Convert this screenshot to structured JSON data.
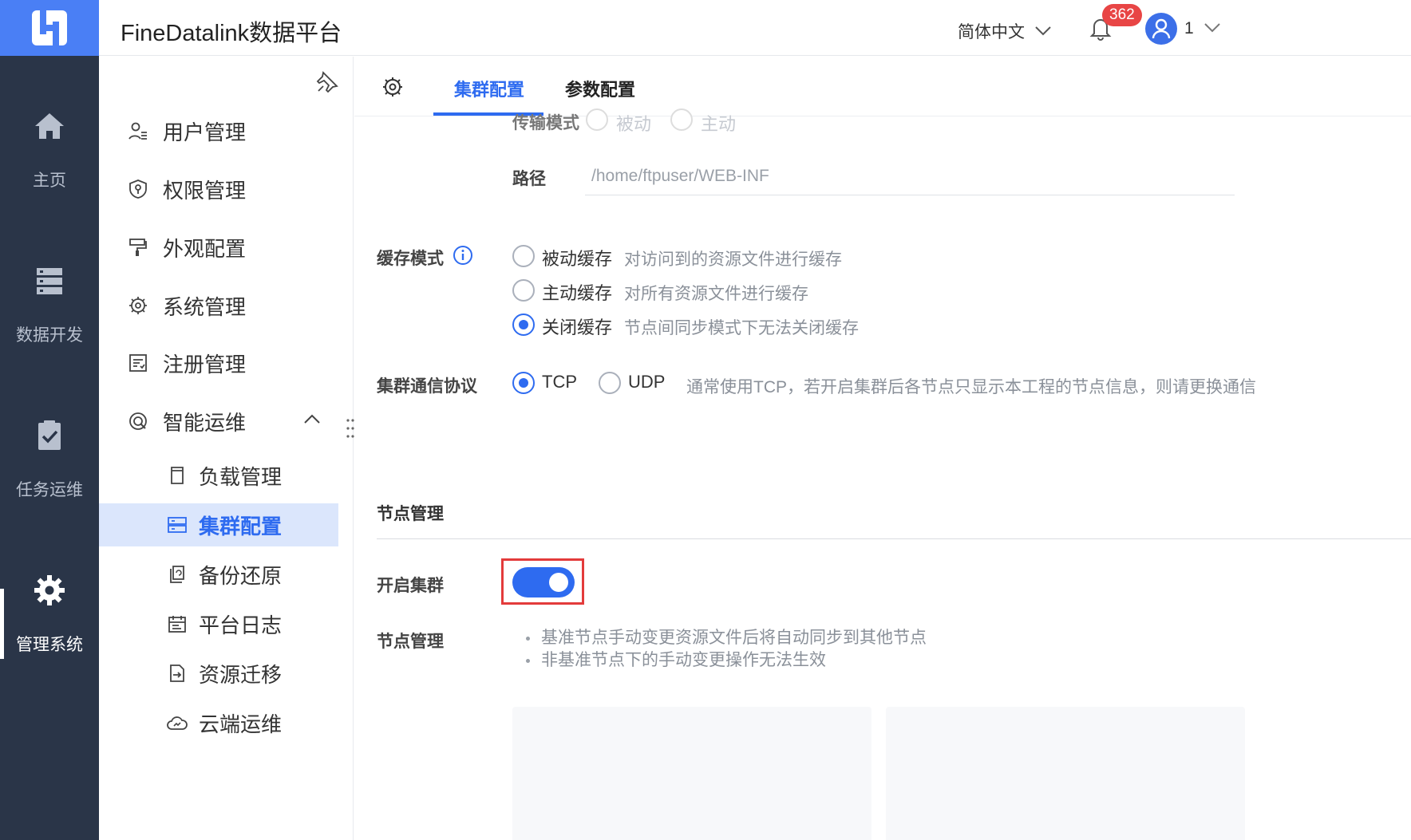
{
  "app": {
    "title": "FineDatalink数据平台",
    "language": "简体中文",
    "notification_count": "362",
    "user_name": "1"
  },
  "rail": {
    "items": [
      {
        "label": "主页",
        "icon": "home-icon"
      },
      {
        "label": "数据开发",
        "icon": "server-icon"
      },
      {
        "label": "任务运维",
        "icon": "clipboard-check-icon"
      },
      {
        "label": "管理系统",
        "icon": "gear-icon",
        "active": true
      }
    ]
  },
  "sidebar": {
    "items": [
      {
        "label": "用户管理",
        "icon": "user-list-icon"
      },
      {
        "label": "权限管理",
        "icon": "shield-key-icon"
      },
      {
        "label": "外观配置",
        "icon": "paint-roller-icon"
      },
      {
        "label": "系统管理",
        "icon": "gear-icon"
      },
      {
        "label": "注册管理",
        "icon": "register-icon"
      },
      {
        "label": "智能运维",
        "icon": "ops-icon",
        "expanded": true
      }
    ],
    "sub_items": [
      {
        "label": "负载管理",
        "icon": "card-icon"
      },
      {
        "label": "集群配置",
        "icon": "server-rack-icon",
        "active": true
      },
      {
        "label": "备份还原",
        "icon": "backup-icon"
      },
      {
        "label": "平台日志",
        "icon": "calendar-log-icon"
      },
      {
        "label": "资源迁移",
        "icon": "migrate-icon"
      },
      {
        "label": "云端运维",
        "icon": "cloud-icon"
      }
    ]
  },
  "tabs": {
    "items": [
      {
        "label": "集群配置",
        "active": true
      },
      {
        "label": "参数配置",
        "active": false
      }
    ]
  },
  "config": {
    "transfer_mode": {
      "label": "传输模式",
      "options": [
        "被动",
        "主动"
      ]
    },
    "path": {
      "label": "路径",
      "value": "/home/ftpuser/WEB-INF"
    },
    "cache_mode": {
      "label": "缓存模式",
      "options": [
        {
          "label": "被动缓存",
          "desc": "对访问到的资源文件进行缓存",
          "checked": false
        },
        {
          "label": "主动缓存",
          "desc": "对所有资源文件进行缓存",
          "checked": false
        },
        {
          "label": "关闭缓存",
          "desc": "节点间同步模式下无法关闭缓存",
          "checked": true
        }
      ]
    },
    "protocol": {
      "label": "集群通信协议",
      "options": [
        {
          "label": "TCP",
          "checked": true
        },
        {
          "label": "UDP",
          "checked": false
        }
      ],
      "desc": "通常使用TCP，若开启集群后各节点只显示本工程的节点信息，则请更换通信"
    }
  },
  "node_section": {
    "title": "节点管理",
    "enable_label": "开启集群",
    "enabled": true,
    "manage_label": "节点管理",
    "notes": [
      "基准节点手动变更资源文件后将自动同步到其他节点",
      "非基准节点下的手动变更操作无法生效"
    ]
  },
  "colors": {
    "accent": "#2e6bf0",
    "rail_bg": "#2a3548",
    "logo_bg": "#4a7ff5",
    "highlight": "#e33b3b",
    "badge": "#e84545"
  }
}
